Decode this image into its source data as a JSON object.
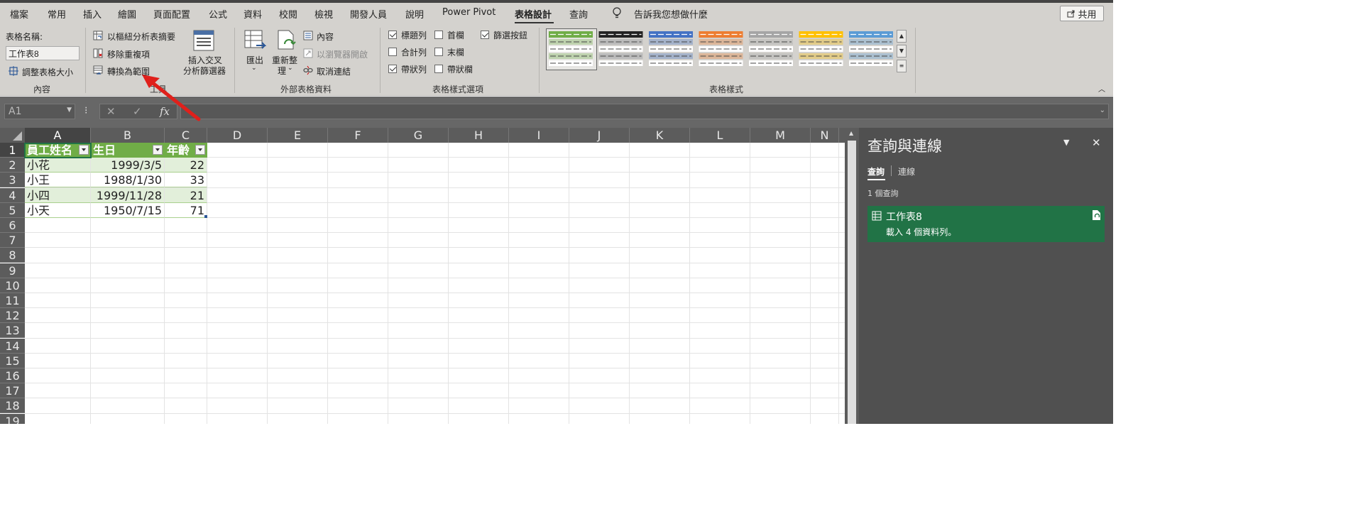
{
  "ribbon_tabs": {
    "file": "檔案",
    "home": "常用",
    "insert": "插入",
    "draw": "繪圖",
    "layout": "頁面配置",
    "formulas": "公式",
    "data": "資料",
    "review": "校閱",
    "view": "檢視",
    "developer": "開發人員",
    "help": "說明",
    "powerpivot": "Power Pivot",
    "table_design": "表格設計",
    "query": "查詢",
    "tell_me": "告訴我您想做什麼",
    "share": "共用"
  },
  "group_properties": {
    "table_name_label": "表格名稱:",
    "table_name_value": "工作表8",
    "resize_label": "調整表格大小",
    "group_label": "內容"
  },
  "group_tools": {
    "pivot_label": "以樞紐分析表摘要",
    "remove_dup_label": "移除重複項",
    "convert_label": "轉換為範圍",
    "slicer_label_1": "插入交叉",
    "slicer_label_2": "分析篩選器",
    "group_label": "工具"
  },
  "group_external": {
    "export_label": "匯出",
    "refresh_label_1": "重新整",
    "refresh_label_2": "理",
    "properties_label": "內容",
    "open_browser_label": "以瀏覽器開啟",
    "unlink_label": "取消連結",
    "group_label": "外部表格資料"
  },
  "group_style_options": {
    "header_row": "標題列",
    "first_column": "首欄",
    "filter_button": "篩選按鈕",
    "total_row": "合計列",
    "last_column": "末欄",
    "banded_rows": "帶狀列",
    "banded_columns": "帶狀欄",
    "group_label": "表格樣式選項"
  },
  "group_styles": {
    "group_label": "表格樣式",
    "swatch_colors": [
      "#70ad47",
      "#222222",
      "#4472c4",
      "#ed7d31",
      "#a5a5a5",
      "#ffc000",
      "#5b9bd5"
    ]
  },
  "formula_bar": {
    "name_box": "A1",
    "fx": "fx"
  },
  "sheet": {
    "columns": [
      "A",
      "B",
      "C",
      "D",
      "E",
      "F",
      "G",
      "H",
      "I",
      "J",
      "K",
      "L",
      "M",
      "N"
    ],
    "rows": [
      "1",
      "2",
      "3",
      "4",
      "5",
      "6",
      "7",
      "8",
      "9",
      "10",
      "11",
      "12",
      "13",
      "14",
      "15",
      "16",
      "17",
      "18",
      "19"
    ],
    "table_headers": [
      "員工姓名",
      "生日",
      "年齡"
    ],
    "table_rows": [
      [
        "小花",
        "1999/3/5",
        "22"
      ],
      [
        "小王",
        "1988/1/30",
        "33"
      ],
      [
        "小四",
        "1999/11/28",
        "21"
      ],
      [
        "小天",
        "1950/7/15",
        "71"
      ]
    ]
  },
  "pane": {
    "title": "查詢與連線",
    "tab_queries": "查詢",
    "tab_connections": "連線",
    "count": "1 個查詢",
    "query_name": "工作表8",
    "query_status": "載入 4 個資料列。"
  }
}
